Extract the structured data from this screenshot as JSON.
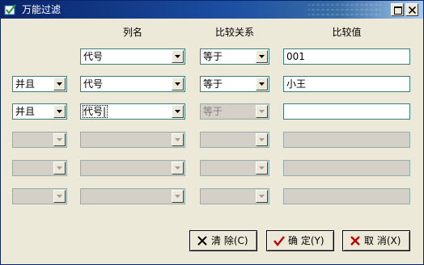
{
  "window": {
    "title": "万能过滤"
  },
  "headers": {
    "column": "列名",
    "operator": "比较关系",
    "value": "比较值"
  },
  "rows": [
    {
      "logic": "",
      "column": "代号",
      "operator": "等于",
      "value": "001"
    },
    {
      "logic": "并且",
      "column": "代号",
      "operator": "等于",
      "value": "小王"
    },
    {
      "logic": "并且",
      "column": "代号|",
      "operator": "等于",
      "value": ""
    },
    {
      "logic": "",
      "column": "",
      "operator": "",
      "value": ""
    },
    {
      "logic": "",
      "column": "",
      "operator": "",
      "value": ""
    },
    {
      "logic": "",
      "column": "",
      "operator": "",
      "value": ""
    }
  ],
  "buttons": {
    "clear": "清 除(C)",
    "ok": "确 定(Y)",
    "cancel": "取 消(X)"
  },
  "colors": {
    "title_bar": "#0a246a",
    "field_border": "#3c7f7a",
    "face": "#ece9d8",
    "ok_check": "#c00000",
    "cancel_x": "#c00000"
  }
}
